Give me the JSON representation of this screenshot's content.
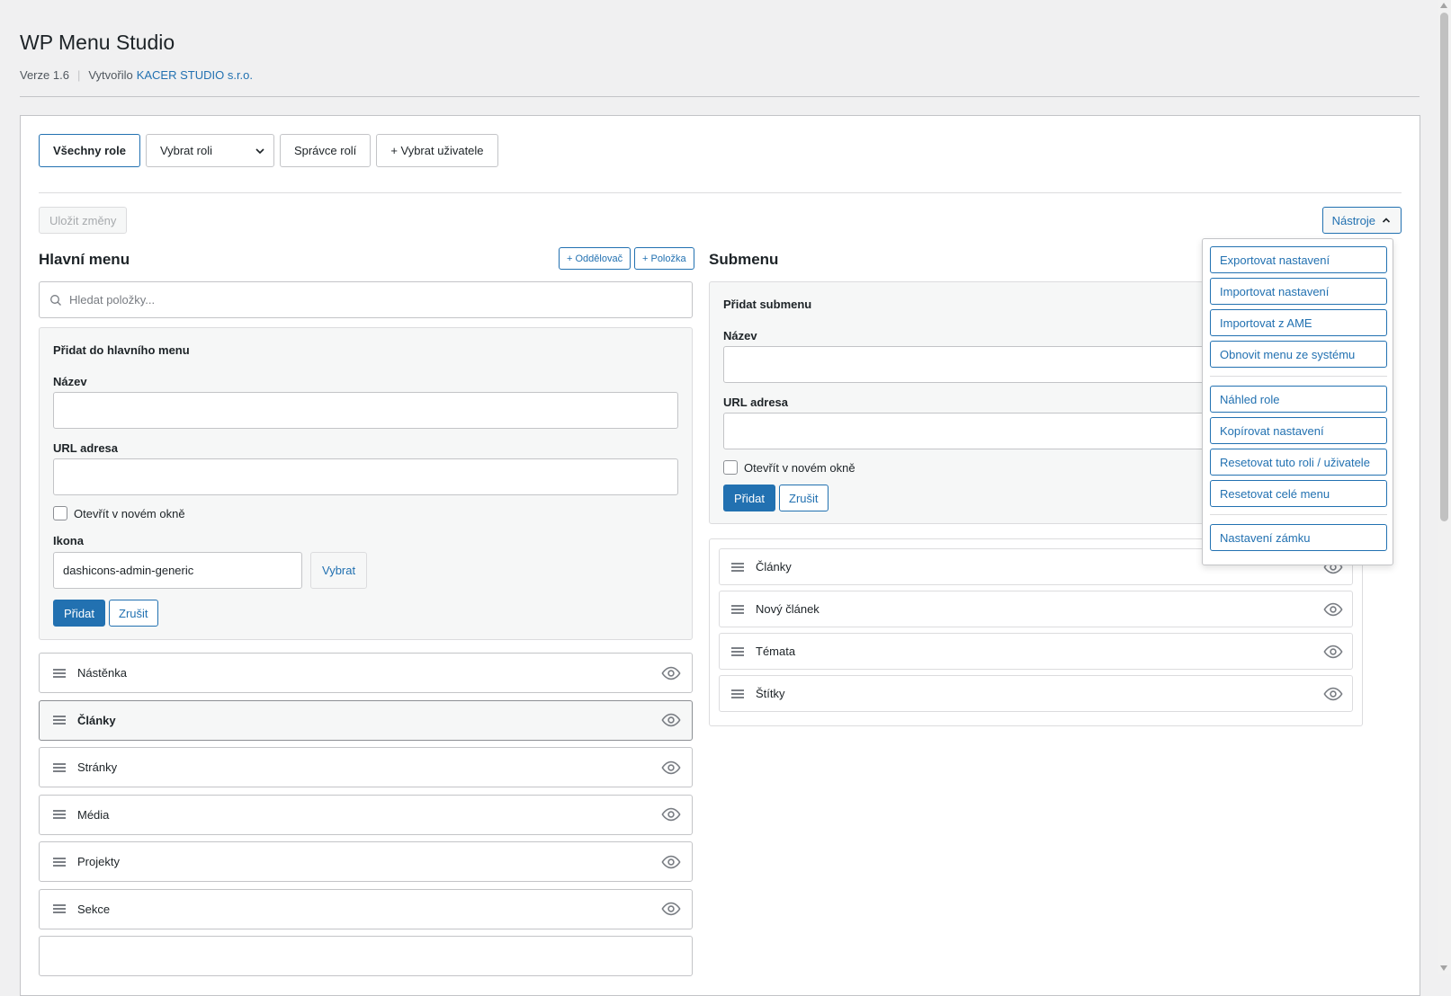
{
  "header": {
    "title": "WP Menu Studio",
    "version": "Verze 1.6",
    "separator": "|",
    "created_by": "Vytvořilo",
    "author_link": "KACER STUDIO s.r.o."
  },
  "role_bar": {
    "all_roles": "Všechny role",
    "select_role": "Vybrat roli",
    "role_manager": "Správce rolí",
    "select_user": "+ Vybrat uživatele"
  },
  "toolbar": {
    "save": "Uložit změny",
    "tools": "Nástroje"
  },
  "main_menu": {
    "title": "Hlavní menu",
    "add_separator": "+ Oddělovač",
    "add_item": "+ Položka",
    "search_placeholder": "Hledat položky...",
    "form": {
      "heading": "Přidat do hlavního menu",
      "name_label": "Název",
      "name_value": "",
      "url_label": "URL adresa",
      "url_value": "",
      "new_window_label": "Otevřít v novém okně",
      "icon_label": "Ikona",
      "icon_value": "dashicons-admin-generic",
      "choose_label": "Vybrat",
      "add_label": "Přidat",
      "cancel_label": "Zrušit"
    },
    "items": [
      {
        "label": "Nástěnka"
      },
      {
        "label": "Články",
        "selected": true
      },
      {
        "label": "Stránky"
      },
      {
        "label": "Média"
      },
      {
        "label": "Projekty"
      },
      {
        "label": "Sekce"
      }
    ]
  },
  "submenu": {
    "title": "Submenu",
    "form": {
      "heading": "Přidat submenu",
      "name_label": "Název",
      "name_value": "",
      "url_label": "URL adresa",
      "url_value": "",
      "new_window_label": "Otevřít v novém okně",
      "add_label": "Přidat",
      "cancel_label": "Zrušit"
    },
    "items": [
      {
        "label": "Články"
      },
      {
        "label": "Nový článek"
      },
      {
        "label": "Témata"
      },
      {
        "label": "Štítky"
      }
    ]
  },
  "tools_menu": {
    "items": [
      "Exportovat nastavení",
      "Importovat nastavení",
      "Importovat z AME",
      "Obnovit menu ze systému",
      "Náhled role",
      "Kopírovat nastavení",
      "Resetovat tuto roli / uživatele",
      "Resetovat celé menu",
      "Nastavení zámku"
    ]
  },
  "colors": {
    "accent": "#2271b1",
    "background": "#f0f0f1",
    "border": "#c3c4c7",
    "text": "#1d2327"
  },
  "icons": {
    "drag": "drag-handle-icon",
    "visibility": "eye-icon",
    "search": "search-icon",
    "chevron_down": "chevron-down-icon",
    "chevron_up": "chevron-up-icon"
  }
}
